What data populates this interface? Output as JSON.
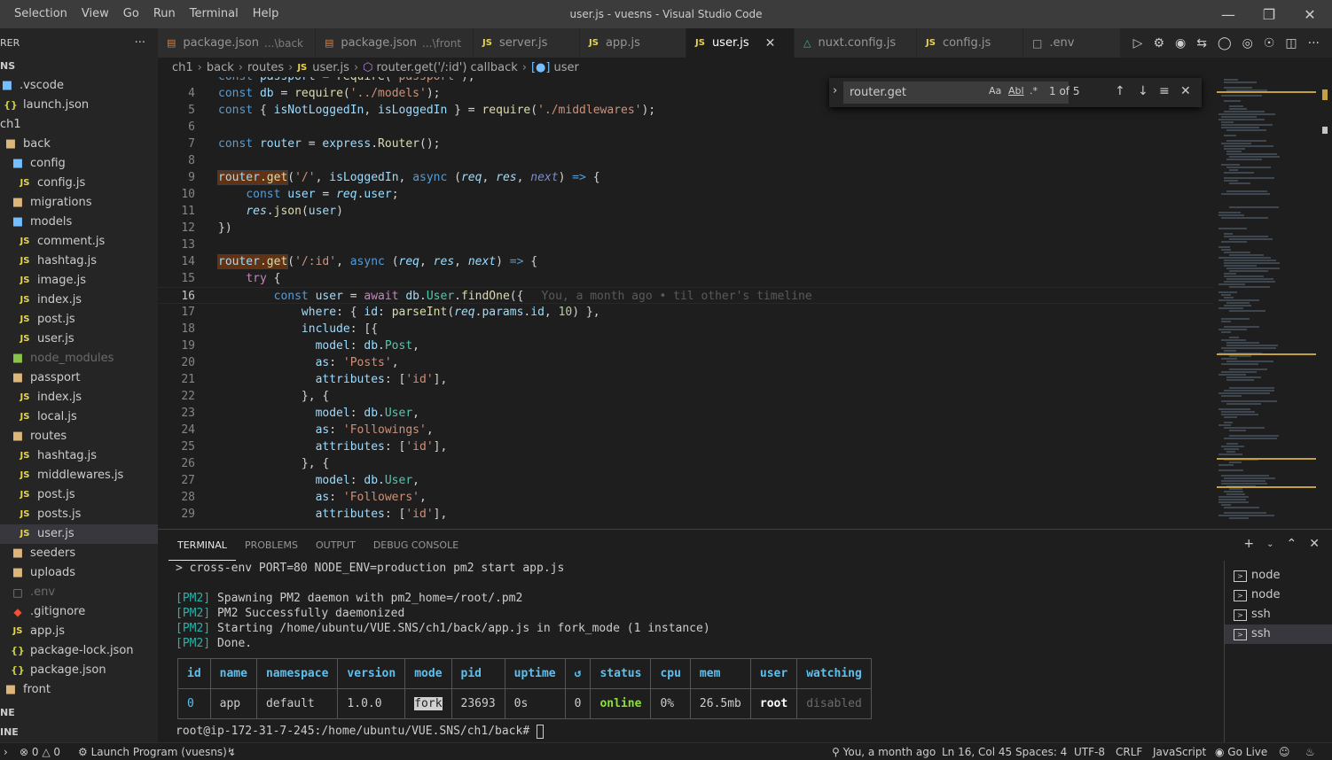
{
  "window": {
    "title": "user.js - vuesns - Visual Studio Code",
    "menu": [
      "Selection",
      "View",
      "Go",
      "Run",
      "Terminal",
      "Help"
    ]
  },
  "sidebar": {
    "header": "RER",
    "more": "···",
    "section": "NS",
    "bottom_sections": [
      "NE",
      "INE"
    ],
    "items": [
      {
        "label": ".vscode",
        "icon": "folder-blue-icon",
        "indent": 4
      },
      {
        "label": "launch.json",
        "icon": "json-icon",
        "indent": 12
      },
      {
        "label": "ch1",
        "icon": "",
        "indent": 4
      },
      {
        "label": "back",
        "icon": "folder-icon",
        "indent": 12
      },
      {
        "label": "config",
        "icon": "folder-blue-icon",
        "indent": 20
      },
      {
        "label": "config.js",
        "icon": "js-icon",
        "indent": 28
      },
      {
        "label": "migrations",
        "icon": "folder-icon",
        "indent": 20
      },
      {
        "label": "models",
        "icon": "folder-blue-icon",
        "indent": 20
      },
      {
        "label": "comment.js",
        "icon": "js-icon",
        "indent": 28
      },
      {
        "label": "hashtag.js",
        "icon": "js-icon",
        "indent": 28
      },
      {
        "label": "image.js",
        "icon": "js-icon",
        "indent": 28
      },
      {
        "label": "index.js",
        "icon": "js-icon",
        "indent": 28
      },
      {
        "label": "post.js",
        "icon": "js-icon",
        "indent": 28
      },
      {
        "label": "user.js",
        "icon": "js-icon",
        "indent": 28
      },
      {
        "label": "node_modules",
        "icon": "folder-green-icon",
        "indent": 20,
        "dim": true
      },
      {
        "label": "passport",
        "icon": "folder-icon",
        "indent": 20
      },
      {
        "label": "index.js",
        "icon": "js-icon",
        "indent": 28
      },
      {
        "label": "local.js",
        "icon": "js-icon",
        "indent": 28
      },
      {
        "label": "routes",
        "icon": "folder-icon",
        "indent": 20
      },
      {
        "label": "hashtag.js",
        "icon": "js-icon",
        "indent": 28
      },
      {
        "label": "middlewares.js",
        "icon": "js-icon",
        "indent": 28
      },
      {
        "label": "post.js",
        "icon": "js-icon",
        "indent": 28
      },
      {
        "label": "posts.js",
        "icon": "js-icon",
        "indent": 28
      },
      {
        "label": "user.js",
        "icon": "js-icon",
        "indent": 28,
        "active": true
      },
      {
        "label": "seeders",
        "icon": "folder-icon",
        "indent": 20
      },
      {
        "label": "uploads",
        "icon": "folder-icon",
        "indent": 20
      },
      {
        "label": ".env",
        "icon": "file-icon",
        "indent": 20,
        "dim": true
      },
      {
        "label": ".gitignore",
        "icon": "git-icon",
        "indent": 20
      },
      {
        "label": "app.js",
        "icon": "js-icon",
        "indent": 20
      },
      {
        "label": "package-lock.json",
        "icon": "json-icon",
        "indent": 20
      },
      {
        "label": "package.json",
        "icon": "json-icon",
        "indent": 20
      },
      {
        "label": "front",
        "icon": "folder-icon",
        "indent": 12
      }
    ]
  },
  "tabs": [
    {
      "label": "package.json",
      "desc": "...\\back",
      "kind": "json"
    },
    {
      "label": "package.json",
      "desc": "...\\front",
      "kind": "json"
    },
    {
      "label": "server.js",
      "kind": "js"
    },
    {
      "label": "app.js",
      "kind": "js"
    },
    {
      "label": "user.js",
      "kind": "js",
      "active": true
    },
    {
      "label": "nuxt.config.js",
      "kind": "nuxt"
    },
    {
      "label": "config.js",
      "kind": "js"
    },
    {
      "label": ".env",
      "kind": "env"
    }
  ],
  "breadcrumb": {
    "parts": [
      "ch1",
      "back",
      "routes"
    ],
    "file": "user.js",
    "symbol": "router.get('/:id') callback",
    "variable": "user"
  },
  "find": {
    "query": "router.get",
    "count": "1 of 5",
    "opts": [
      "Aa",
      "Abl",
      ".*"
    ]
  },
  "editor": {
    "current_line": 16,
    "blame": "You, a month ago • til other's timeline",
    "first_line_partial": "const passport = require('passport');"
  },
  "panel": {
    "tabs": [
      "TERMINAL",
      "PROBLEMS",
      "OUTPUT",
      "DEBUG CONSOLE"
    ],
    "command": "> cross-env PORT=80 NODE_ENV=production pm2 start app.js",
    "pm2_lines": [
      {
        "tag": "[PM2]",
        "text": " Spawning PM2 daemon with pm2_home=/root/.pm2"
      },
      {
        "tag": "[PM2]",
        "text": " PM2 Successfully daemonized"
      },
      {
        "tag": "[PM2]",
        "text": " Starting /home/ubuntu/VUE.SNS/ch1/back/app.js in fork_mode (1 instance)"
      },
      {
        "tag": "[PM2]",
        "text": " Done."
      }
    ],
    "table": {
      "headers": [
        "id",
        "name",
        "namespace",
        "version",
        "mode",
        "pid",
        "uptime",
        "↺",
        "status",
        "cpu",
        "mem",
        "user",
        "watching"
      ],
      "row": [
        "0",
        "app",
        "default",
        "1.0.0",
        "fork",
        "23693",
        "0s",
        "0",
        "online",
        "0%",
        "26.5mb",
        "root",
        "disabled"
      ]
    },
    "prompt": "root@ip-172-31-7-245:/home/ubuntu/VUE.SNS/ch1/back# ",
    "terminals": [
      {
        "label": "node"
      },
      {
        "label": "node"
      },
      {
        "label": "ssh"
      },
      {
        "label": "ssh",
        "active": true
      }
    ]
  },
  "status": {
    "errors": "0",
    "warnings": "0",
    "launch": "Launch Program (vuesns)",
    "blame": "You, a month ago",
    "position": "Ln 16, Col 45",
    "spaces": "Spaces: 4",
    "encoding": "UTF-8",
    "eol": "CRLF",
    "language": "JavaScript",
    "golive": "Go Live"
  }
}
